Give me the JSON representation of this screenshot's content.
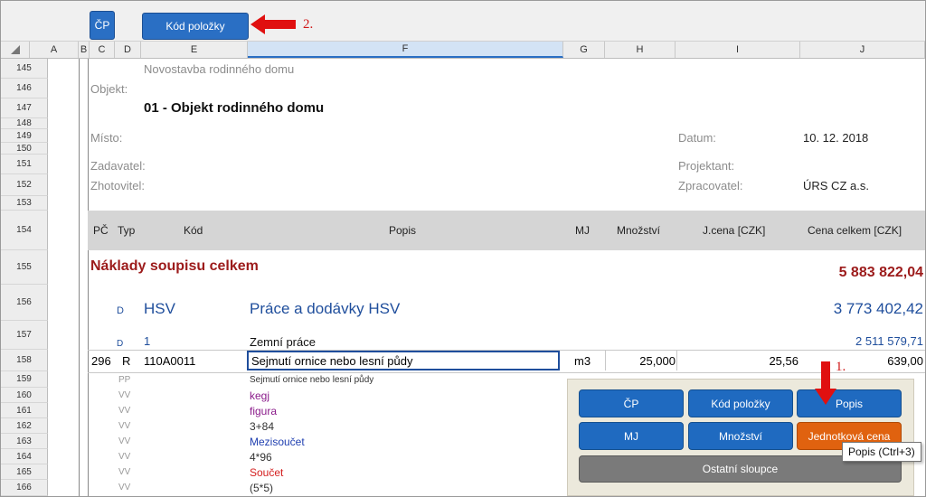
{
  "toolbar": {
    "cp_button": "ČP",
    "code_button": "Kód položky",
    "note2": "2."
  },
  "columns": [
    "A",
    "B",
    "C",
    "D",
    "E",
    "F",
    "G",
    "H",
    "I",
    "J"
  ],
  "rows": [
    "145",
    "146",
    "147",
    "148",
    "149",
    "150",
    "151",
    "152",
    "153",
    "154",
    "155",
    "156",
    "157",
    "158",
    "159",
    "160",
    "161",
    "162",
    "163",
    "164",
    "165",
    "166"
  ],
  "project": {
    "building": "Novostavba rodinného domu",
    "object_label": "Objekt:",
    "object_name": "01 - Objekt rodinného domu",
    "place_label": "Místo:",
    "date_label": "Datum:",
    "date_value": "10. 12. 2018",
    "client_label": "Zadavatel:",
    "designer_label": "Projektant:",
    "contractor_label": "Zhotovitel:",
    "processor_label": "Zpracovatel:",
    "processor_value": "ÚRS CZ a.s."
  },
  "table_header": {
    "pc": "PČ",
    "typ": "Typ",
    "kod": "Kód",
    "popis": "Popis",
    "mj": "MJ",
    "mnozstvi": "Množství",
    "jcena": "J.cena [CZK]",
    "celkem": "Cena celkem [CZK]"
  },
  "totals": {
    "label": "Náklady soupisu celkem",
    "value": "5 883 822,04"
  },
  "hsv": {
    "d": "D",
    "code": "HSV",
    "name": "Práce a dodávky HSV",
    "value": "3 773 402,42"
  },
  "earth": {
    "d": "D",
    "code": "1",
    "name": "Zemní práce",
    "value": "2 511 579,71"
  },
  "item": {
    "pc": "296",
    "typ": "R",
    "kod": "110A0011",
    "popis": "Sejmutí ornice nebo lesní půdy",
    "mj": "m3",
    "mnozstvi": "25,000",
    "jcena": "25,56",
    "celkem": "639,00"
  },
  "details": [
    {
      "type": "PP",
      "text": "Sejmutí ornice nebo lesní půdy",
      "color": "#333333"
    },
    {
      "type": "VV",
      "text": "kegj",
      "color": "#8a1a8a"
    },
    {
      "type": "VV",
      "text": "figura",
      "color": "#8a1a8a"
    },
    {
      "type": "VV",
      "text": "3+84",
      "color": "#333333"
    },
    {
      "type": "VV",
      "text": "Mezisoučet",
      "color": "#1f3fb0"
    },
    {
      "type": "VV",
      "text": "4*96",
      "color": "#333333"
    },
    {
      "type": "VV",
      "text": "Součet",
      "color": "#d42020"
    },
    {
      "type": "VV",
      "text": "(5*5)",
      "color": "#333333"
    }
  ],
  "panel": {
    "cp": "ČP",
    "kod": "Kód položky",
    "popis": "Popis",
    "mj": "MJ",
    "mnozstvi": "Množství",
    "jcena": "Jednotková cena",
    "ostatni": "Ostatní sloupce",
    "note1": "1."
  },
  "tooltip": "Popis (Ctrl+3)",
  "colors": {
    "accent_blue": "#1f6ac0",
    "accent_orange": "#e0620f",
    "arrow_red": "#e01010",
    "total_red": "#9c1b1b"
  }
}
